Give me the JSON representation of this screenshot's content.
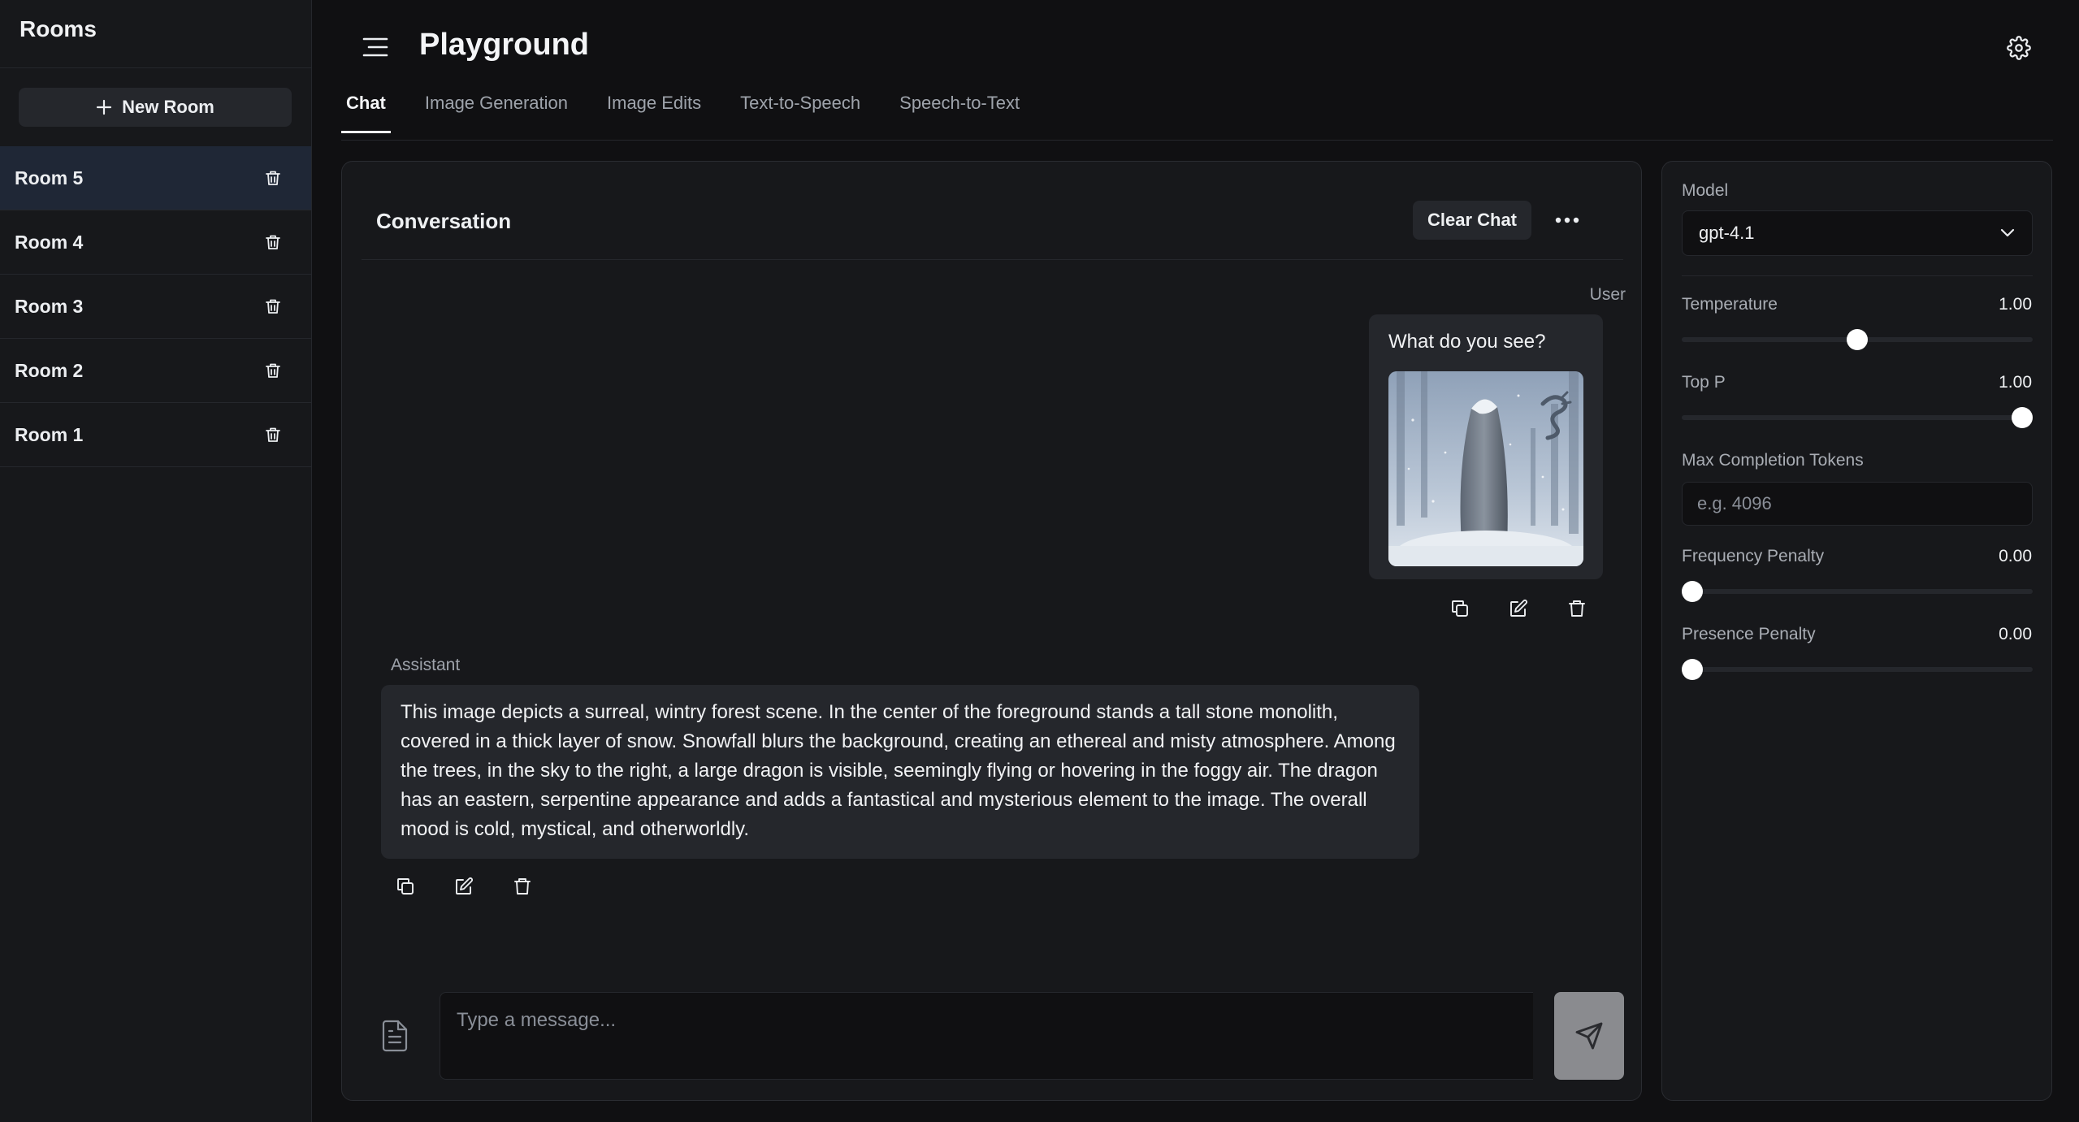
{
  "sidebar": {
    "title": "Rooms",
    "new_room_label": "New Room",
    "rooms": [
      {
        "label": "Room 5",
        "active": true
      },
      {
        "label": "Room 4",
        "active": false
      },
      {
        "label": "Room 3",
        "active": false
      },
      {
        "label": "Room 2",
        "active": false
      },
      {
        "label": "Room 1",
        "active": false
      }
    ]
  },
  "header": {
    "title": "Playground",
    "tabs": [
      {
        "label": "Chat",
        "active": true
      },
      {
        "label": "Image Generation",
        "active": false
      },
      {
        "label": "Image Edits",
        "active": false
      },
      {
        "label": "Text-to-Speech",
        "active": false
      },
      {
        "label": "Speech-to-Text",
        "active": false
      }
    ]
  },
  "conversation": {
    "title": "Conversation",
    "clear_label": "Clear Chat",
    "messages": [
      {
        "role": "User",
        "text": "What do you see?",
        "image": "snowy-forest-monolith-dragon"
      },
      {
        "role": "Assistant",
        "text": "This image depicts a surreal, wintry forest scene. In the center of the foreground stands a tall stone monolith, covered in a thick layer of snow. Snowfall blurs the background, creating an ethereal and misty atmosphere. Among the trees, in the sky to the right, a large dragon is visible, seemingly flying or hovering in the foggy air. The dragon has an eastern, serpentine appearance and adds a fantastical and mysterious element to the image. The overall mood is cold, mystical, and otherworldly."
      }
    ],
    "input_placeholder": "Type a message..."
  },
  "settings": {
    "model_label": "Model",
    "model_value": "gpt-4.1",
    "temperature": {
      "label": "Temperature",
      "value": "1.00",
      "fraction": 0.5
    },
    "top_p": {
      "label": "Top P",
      "value": "1.00",
      "fraction": 1.0
    },
    "max_tokens": {
      "label": "Max Completion Tokens",
      "placeholder": "e.g. 4096"
    },
    "frequency_penalty": {
      "label": "Frequency Penalty",
      "value": "0.00",
      "fraction": 0.0
    },
    "presence_penalty": {
      "label": "Presence Penalty",
      "value": "0.00",
      "fraction": 0.0
    }
  },
  "icons": {
    "menu": "menu-icon",
    "settings": "gear-icon",
    "plus": "plus-icon",
    "trash": "trash-icon",
    "more": "more-horizontal-icon",
    "copy": "copy-icon",
    "edit": "edit-icon",
    "attach": "document-icon",
    "send": "send-icon",
    "chevron": "chevron-down-icon"
  },
  "colors": {
    "background": "#101012",
    "panel": "#17181b",
    "surface": "#25272c",
    "active_room": "#1f2736",
    "send_button": "#8a8b8f"
  }
}
